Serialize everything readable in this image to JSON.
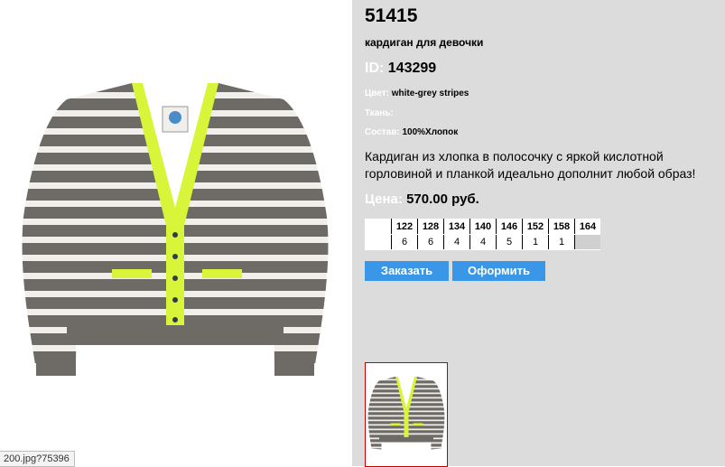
{
  "product": {
    "sku": "51415",
    "subtitle": "кардиган для девочки",
    "id_label": "ID:",
    "id_value": "143299",
    "color_label": "Цвет:",
    "color_value": "white-grey stripes",
    "fabric_label": "Ткань:",
    "fabric_value": "",
    "composition_label": "Состав:",
    "composition_value": "100%Хлопок",
    "description": "Кардиган из хлопка в полосочку с яркой кислотной горловиной и планкой идеально дополнит любой образ!",
    "price_label": "Цена:",
    "price_value": "570.00 руб."
  },
  "sizes": {
    "headers": [
      "122",
      "128",
      "134",
      "140",
      "146",
      "152",
      "158",
      "164"
    ],
    "quantities": [
      "6",
      "6",
      "4",
      "4",
      "5",
      "1",
      "1",
      ""
    ]
  },
  "buttons": {
    "order": "Заказать",
    "checkout": "Оформить"
  },
  "status_tip": "200.jpg?75396",
  "colors": {
    "panel_bg": "#dcdcdc",
    "button": "#3a97e8",
    "stripe_grey": "#6e6a66",
    "stripe_white": "#f1efeb",
    "trim": "#d8f53a",
    "thumb_border": "#c00000"
  }
}
